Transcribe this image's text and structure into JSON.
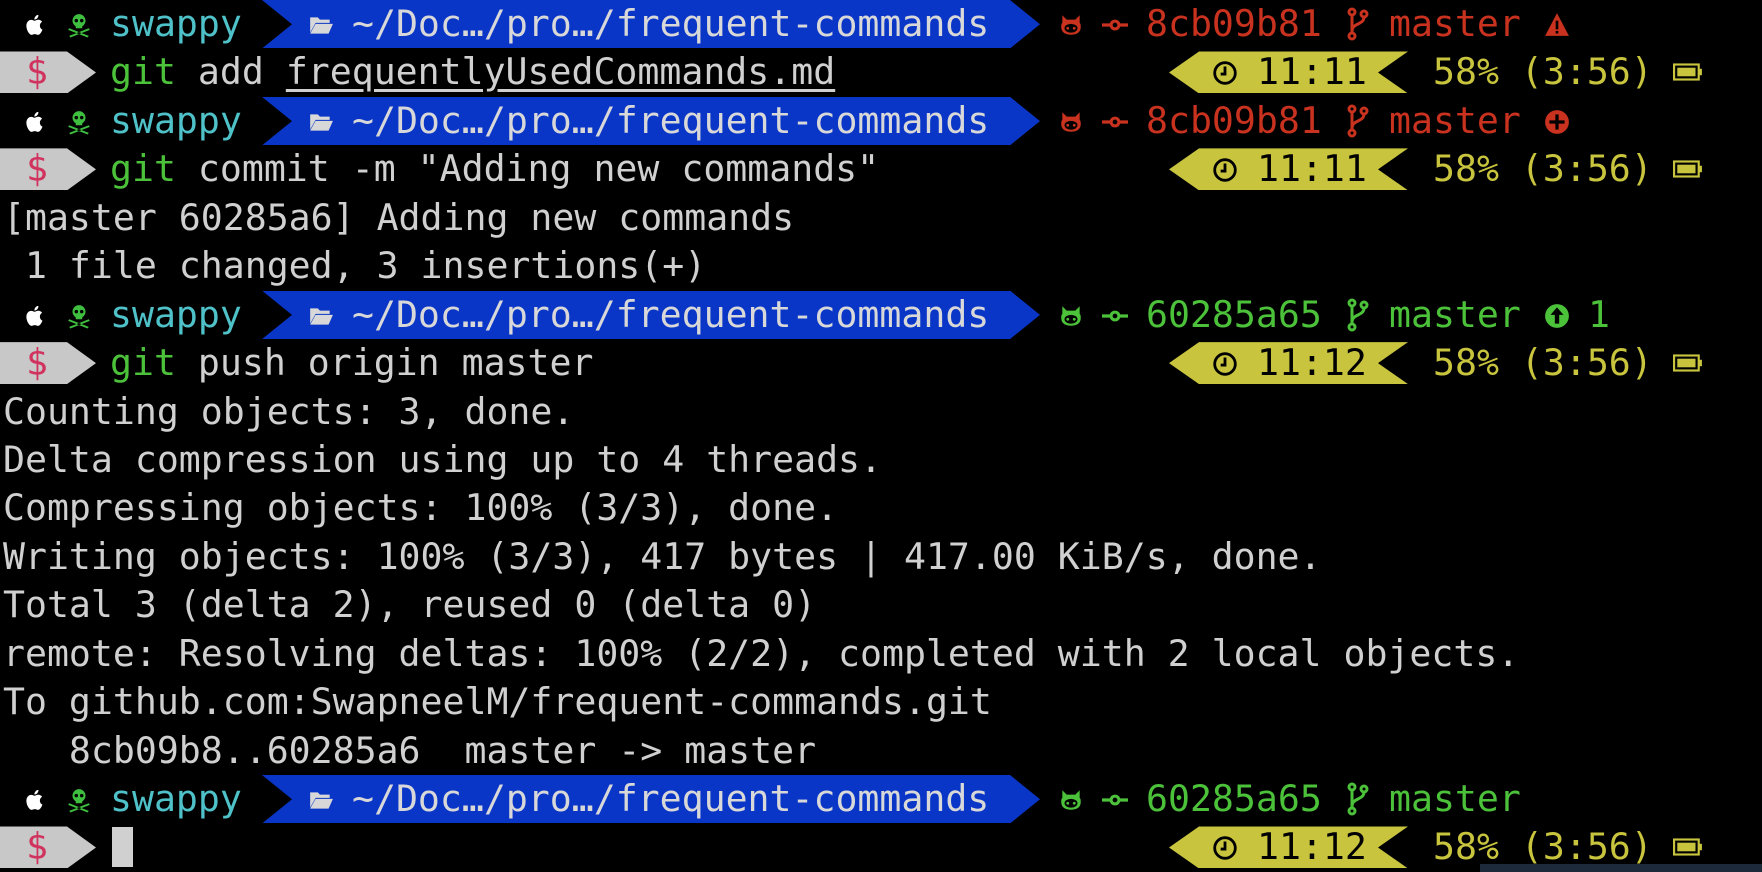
{
  "colors": {
    "user": "#4fc1c8",
    "skull": "#3fbf3f",
    "path_bg": "#0a36c8",
    "path_text": "#d8d8d8",
    "git_dirty": "#c8321e",
    "git_clean": "#4cc13a",
    "command": "#4cc13a",
    "dollar": "#d1335f",
    "time_bg": "#c8c43e",
    "battery": "#c8c43e",
    "text": "#d0d0d0"
  },
  "terminal": {
    "lines": [
      {
        "type": "prompt",
        "os_icon": "apple-icon",
        "skull_icon": "skull-icon",
        "user": "swappy",
        "folder_icon": "folder-icon",
        "path": "~/Doc…/pro…/frequent-commands",
        "state": "dirty",
        "hash": "8cb09b81",
        "branch": "master",
        "status_icon": "warning-icon",
        "status_text": ""
      },
      {
        "type": "command",
        "prompt": "$",
        "cmd": "git",
        "args": " add ",
        "arg_underlined": "frequentlyUsedCommands.md",
        "time": "11:11",
        "battery": "58% (3:56)"
      },
      {
        "type": "prompt",
        "os_icon": "apple-icon",
        "skull_icon": "skull-icon",
        "user": "swappy",
        "folder_icon": "folder-icon",
        "path": "~/Doc…/pro…/frequent-commands",
        "state": "dirty",
        "hash": "8cb09b81",
        "branch": "master",
        "status_icon": "plus-circle-icon",
        "status_text": ""
      },
      {
        "type": "command",
        "prompt": "$",
        "cmd": "git",
        "args": " commit -m \"Adding new commands\"",
        "arg_underlined": "",
        "time": "11:11",
        "battery": "58% (3:56)"
      },
      {
        "type": "output",
        "text": "[master 60285a6] Adding new commands"
      },
      {
        "type": "output",
        "text": " 1 file changed, 3 insertions(+)"
      },
      {
        "type": "prompt",
        "os_icon": "apple-icon",
        "skull_icon": "skull-icon",
        "user": "swappy",
        "folder_icon": "folder-icon",
        "path": "~/Doc…/pro…/frequent-commands",
        "state": "clean",
        "hash": "60285a65",
        "branch": "master",
        "status_icon": "arrow-up-circle-icon",
        "status_text": "1"
      },
      {
        "type": "command",
        "prompt": "$",
        "cmd": "git",
        "args": " push origin master",
        "arg_underlined": "",
        "time": "11:12",
        "battery": "58% (3:56)"
      },
      {
        "type": "output",
        "text": "Counting objects: 3, done."
      },
      {
        "type": "output",
        "text": "Delta compression using up to 4 threads."
      },
      {
        "type": "output",
        "text": "Compressing objects: 100% (3/3), done."
      },
      {
        "type": "output",
        "text": "Writing objects: 100% (3/3), 417 bytes | 417.00 KiB/s, done."
      },
      {
        "type": "output",
        "text": "Total 3 (delta 2), reused 0 (delta 0)"
      },
      {
        "type": "output",
        "text": "remote: Resolving deltas: 100% (2/2), completed with 2 local objects."
      },
      {
        "type": "output",
        "text": "To github.com:SwapneelM/frequent-commands.git"
      },
      {
        "type": "output",
        "text": "   8cb09b8..60285a6  master -> master"
      },
      {
        "type": "prompt",
        "os_icon": "apple-icon",
        "skull_icon": "skull-icon",
        "user": "swappy",
        "folder_icon": "folder-icon",
        "path": "~/Doc…/pro…/frequent-commands",
        "state": "clean",
        "hash": "60285a65",
        "branch": "master",
        "status_icon": "",
        "status_text": ""
      },
      {
        "type": "command",
        "prompt": "$",
        "cmd": "",
        "args": "",
        "arg_underlined": "",
        "cursor": true,
        "time": "11:12",
        "battery": "58% (3:56)"
      }
    ]
  }
}
